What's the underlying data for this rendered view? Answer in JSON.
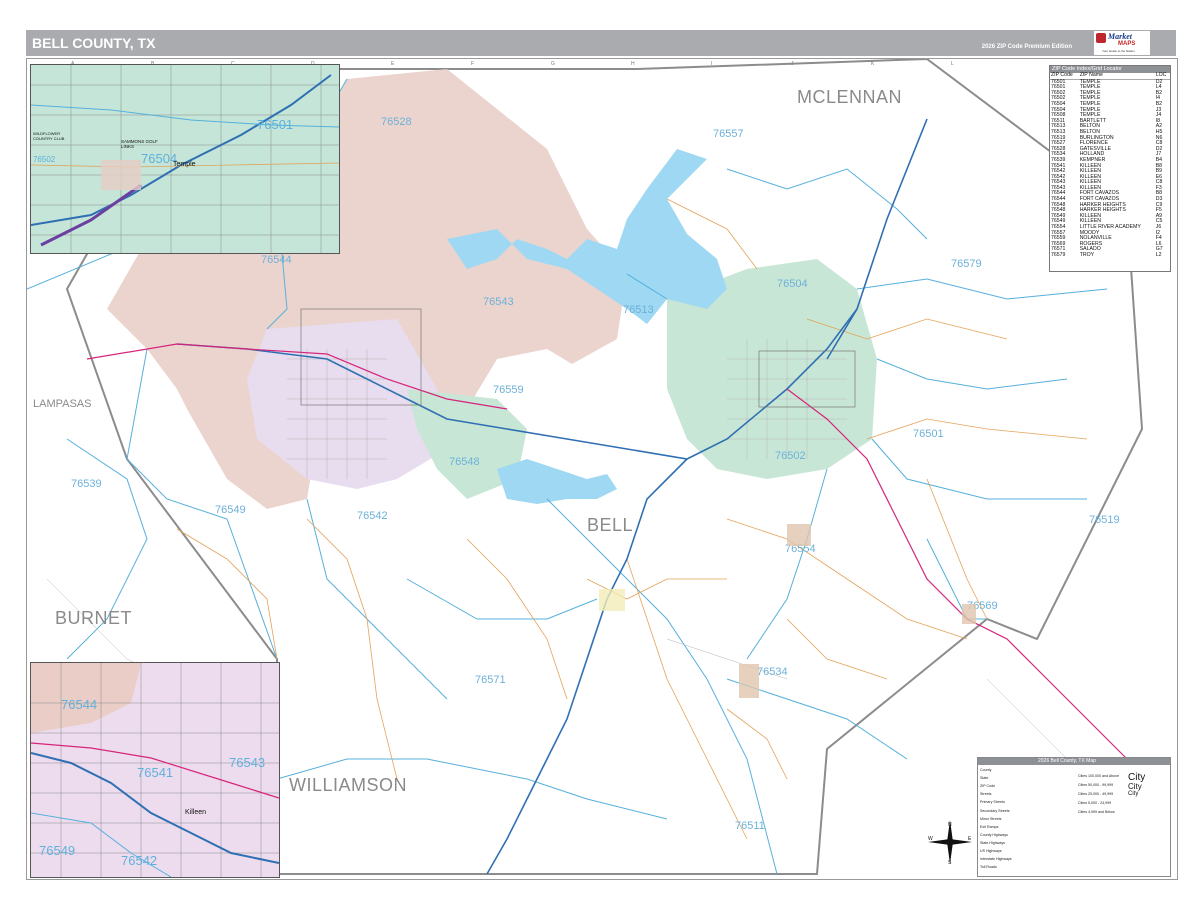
{
  "header": {
    "title": "BELL COUNTY, TX",
    "edition": "2026 ZIP Code Premium Edition",
    "logo_market": "Market",
    "logo_maps": "MAPS",
    "logo_sub": "Your Guide to the Nation"
  },
  "counties": {
    "mclennan": "MCLENNAN",
    "bell": "BELL",
    "burnet": "BURNET",
    "williamson": "WILLIAMSON",
    "lampasas": "LAMPASAS"
  },
  "zips": {
    "z76528": "76528",
    "z76557": "76557",
    "z76544": "76544",
    "z76579": "76579",
    "z76504": "76504",
    "z76543": "76543",
    "z76513": "76513",
    "z76559": "76559",
    "z76501": "76501",
    "z76502": "76502",
    "z76548": "76548",
    "z76539": "76539",
    "z76549": "76549",
    "z76542": "76542",
    "z76519": "76519",
    "z76554": "76554",
    "z76569": "76569",
    "z76534": "76534",
    "z76571": "76571",
    "z76511": "76511"
  },
  "insets": {
    "top": {
      "city": "Temple",
      "zip1": "76501",
      "zip2": "76504",
      "zip3": "76502",
      "place": "SAMMONS GOLF LINKS",
      "place2": "WILDFLOWER COUNTRY CLUB"
    },
    "bottom": {
      "city": "Killeen",
      "zip1": "76544",
      "zip2": "76541",
      "zip3": "76543",
      "zip4": "76549",
      "zip5": "76542"
    }
  },
  "zip_index": {
    "title": "ZIP Code Index/Grid Locator",
    "headers": [
      "ZIP Code",
      "ZIP Name",
      "LOC"
    ],
    "rows": [
      [
        "76501",
        "TEMPLE",
        "D2"
      ],
      [
        "76501",
        "TEMPLE",
        "L4"
      ],
      [
        "76502",
        "TEMPLE",
        "B2"
      ],
      [
        "76502",
        "TEMPLE",
        "I4"
      ],
      [
        "76504",
        "TEMPLE",
        "B2"
      ],
      [
        "76504",
        "TEMPLE",
        "J3"
      ],
      [
        "76508",
        "TEMPLE",
        "J4"
      ],
      [
        "76511",
        "BARTLETT",
        "I8"
      ],
      [
        "76513",
        "BELTON",
        "A2"
      ],
      [
        "76513",
        "BELTON",
        "H5"
      ],
      [
        "76519",
        "BURLINGTON",
        "N6"
      ],
      [
        "76527",
        "FLORENCE",
        "C8"
      ],
      [
        "76528",
        "GATESVILLE",
        "D2"
      ],
      [
        "76534",
        "HOLLAND",
        "J7"
      ],
      [
        "76539",
        "KEMPNER",
        "B4"
      ],
      [
        "76541",
        "KILLEEN",
        "B8"
      ],
      [
        "76542",
        "KILLEEN",
        "B9"
      ],
      [
        "76542",
        "KILLEEN",
        "E6"
      ],
      [
        "76543",
        "KILLEEN",
        "C8"
      ],
      [
        "76543",
        "KILLEEN",
        "F3"
      ],
      [
        "76544",
        "FORT CAVAZOS",
        "B8"
      ],
      [
        "76544",
        "FORT CAVAZOS",
        "D3"
      ],
      [
        "76548",
        "HARKER HEIGHTS",
        "C9"
      ],
      [
        "76548",
        "HARKER HEIGHTS",
        "F5"
      ],
      [
        "76549",
        "KILLEEN",
        "A9"
      ],
      [
        "76549",
        "KILLEEN",
        "C5"
      ],
      [
        "76554",
        "LITTLE RIVER ACADEMY",
        "J6"
      ],
      [
        "76557",
        "MOODY",
        "I2"
      ],
      [
        "76559",
        "NOLANVILLE",
        "F4"
      ],
      [
        "76569",
        "ROGERS",
        "L6"
      ],
      [
        "76571",
        "SALADO",
        "G7"
      ],
      [
        "76579",
        "TROY",
        "L2"
      ]
    ]
  },
  "legend": {
    "title": "2026 Bell County, TX Map",
    "rows": [
      "County",
      "State",
      "ZIP Code",
      "Streets",
      "Primary Streets",
      "Secondary Streets",
      "Minor Streets",
      "Exit Ramps",
      "County Highways",
      "State Highways",
      "US Highways",
      "Interstate Highways",
      "Toll Roads"
    ],
    "cities": [
      "Cities 100,000 and Above",
      "Cities 50,000 - 99,999",
      "Cities 25,000 - 49,999",
      "Cities 5,000 - 24,999",
      "Cities 4,999 and Below"
    ],
    "city_big": "City",
    "city_mid": "City",
    "city_sm": "City"
  },
  "compass": {
    "n": "N",
    "s": "S",
    "e": "E",
    "w": "W"
  },
  "colors": {
    "title_bar": "#a9abae",
    "zip_text": "#6cb1d9",
    "lake": "#9fd8f2",
    "fort": "#e9cdc6",
    "temple_area": "#c8e6d6",
    "killeen_area": "#e8dcef",
    "interstate": "#2f6fb3",
    "us_highway": "#d6247b"
  }
}
